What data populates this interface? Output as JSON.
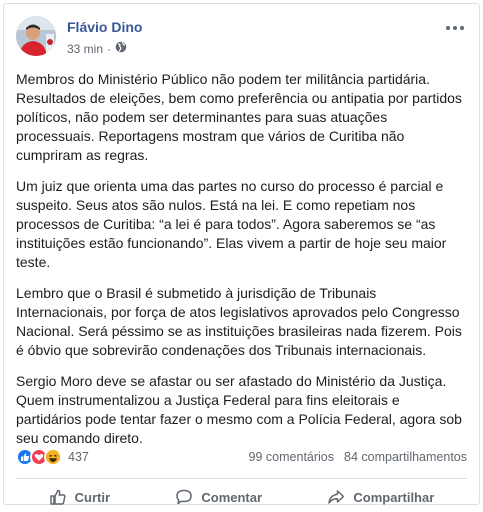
{
  "post": {
    "author": "Flávio Dino",
    "time": "33 min",
    "separator": "·",
    "audience_icon": "globe-icon",
    "paragraphs": [
      "Membros do Ministério Público não podem ter militância partidária. Resultados de eleições, bem como preferência ou antipatia por partidos políticos, não podem ser determinantes para suas atuações processuais. Reportagens mostram que vários de Curitiba não cumpriram as regras.",
      "Um juiz que orienta uma das partes no curso do processo é parcial e suspeito. Seus atos são nulos. Está na lei. E como repetiam nos processos de Curitiba: “a lei é para todos”. Agora saberemos se “as instituições estão funcionando”. Elas vivem a partir de hoje seu maior teste.",
      "Lembro que o Brasil é submetido à jurisdição de Tribunais Internacionais, por força de atos legislativos aprovados pelo Congresso Nacional. Será péssimo se as instituições brasileiras nada fizerem. Pois é óbvio que sobrevirão condenações dos Tribunais internacionais.",
      "Sergio Moro deve se afastar ou ser afastado do Ministério da Justiça. Quem instrumentalizou a Justiça Federal para fins eleitorais e partidários pode tentar fazer o mesmo com a Polícia Federal, agora sob seu comando direto."
    ]
  },
  "stats": {
    "reactions": [
      "like-icon",
      "love-icon",
      "haha-icon"
    ],
    "reaction_count": "437",
    "comments": "99 comentários",
    "shares": "84 compartilhamentos"
  },
  "actions": {
    "like": "Curtir",
    "comment": "Comentar",
    "share": "Compartilhar"
  },
  "colors": {
    "author": "#385898",
    "like": "#1877f2",
    "love": "#f33e58",
    "haha": "#f7b125"
  }
}
